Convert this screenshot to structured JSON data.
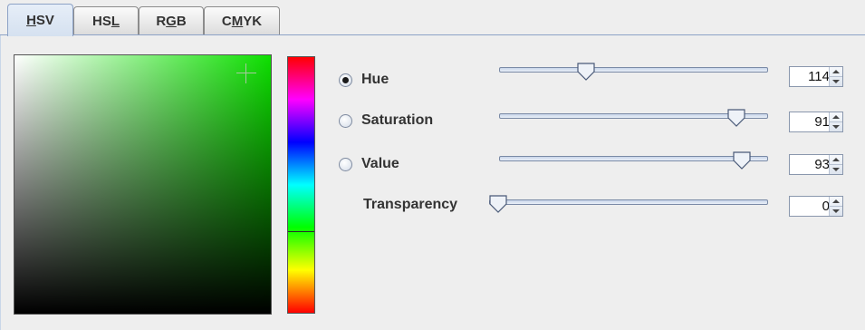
{
  "tabs": [
    {
      "label_pre": "",
      "mnemonic": "H",
      "label_post": "SV",
      "active": true
    },
    {
      "label_pre": "HS",
      "mnemonic": "L",
      "label_post": "",
      "active": false
    },
    {
      "label_pre": "R",
      "mnemonic": "G",
      "label_post": "B",
      "active": false
    },
    {
      "label_pre": "C",
      "mnemonic": "M",
      "label_post": "YK",
      "active": false
    }
  ],
  "current_color": "#0ddf00",
  "sv_picker": {
    "saturation": 91,
    "value": 93
  },
  "hue_bar": {
    "hue": 114
  },
  "rows": [
    {
      "label": "Hue",
      "selected": true,
      "has_radio": true,
      "value": "114",
      "fraction": 0.31
    },
    {
      "label": "Saturation",
      "selected": false,
      "has_radio": true,
      "value": "91",
      "fraction": 0.91
    },
    {
      "label": "Value",
      "selected": false,
      "has_radio": true,
      "value": "93",
      "fraction": 0.93
    },
    {
      "label": "Transparency",
      "selected": false,
      "has_radio": false,
      "value": "0",
      "fraction": 0.0
    }
  ]
}
